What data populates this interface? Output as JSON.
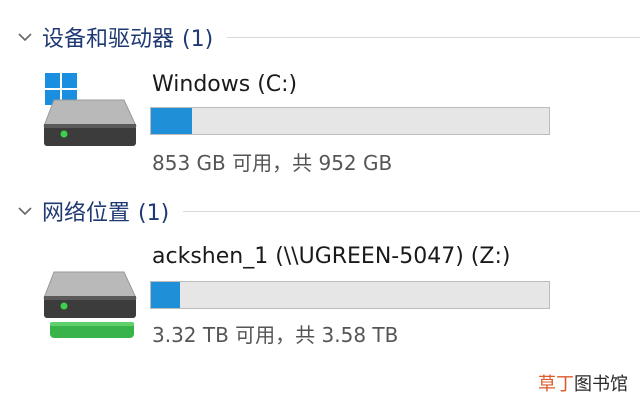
{
  "groups": [
    {
      "title": "设备和驱动器",
      "count": "(1)",
      "drives": [
        {
          "name": "Windows (C:)",
          "space": "853 GB 可用，共 952 GB",
          "used_fraction": 0.104,
          "icon": "windows-system-drive-icon"
        }
      ]
    },
    {
      "title": "网络位置",
      "count": "(1)",
      "drives": [
        {
          "name": "ackshen_1 (\\\\UGREEN-5047) (Z:)",
          "space": "3.32 TB 可用，共 3.58 TB",
          "used_fraction": 0.073,
          "icon": "network-drive-icon"
        }
      ]
    }
  ],
  "watermark": {
    "part1": "草丁",
    "part2": "图书馆"
  },
  "colors": {
    "accent": "#1f8fd8",
    "header": "#1f3a73",
    "network_green": "#38b34a"
  }
}
